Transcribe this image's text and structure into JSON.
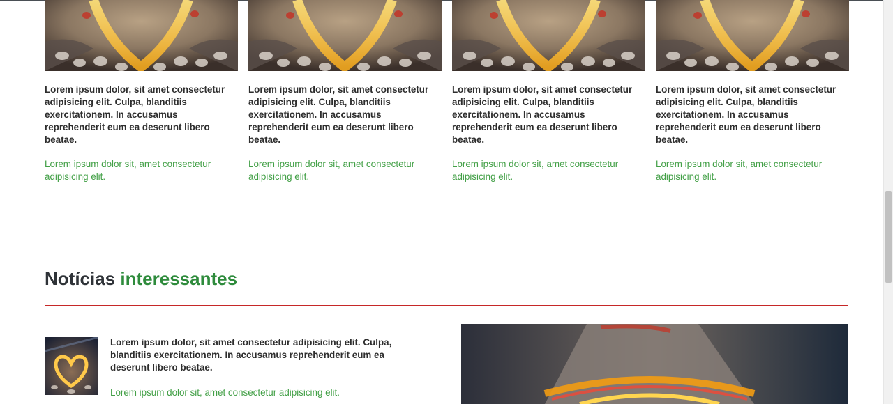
{
  "cards": [
    {
      "title": "Lorem ipsum dolor, sit amet consectetur adipisicing elit. Culpa, blanditiis exercitationem. In accusamus reprehenderit eum ea deserunt libero beatae.",
      "subtitle": "Lorem ipsum dolor sit, amet consectetur adipisicing elit."
    },
    {
      "title": "Lorem ipsum dolor, sit amet consectetur adipisicing elit. Culpa, blanditiis exercitationem. In accusamus reprehenderit eum ea deserunt libero beatae.",
      "subtitle": "Lorem ipsum dolor sit, amet consectetur adipisicing elit."
    },
    {
      "title": "Lorem ipsum dolor, sit amet consectetur adipisicing elit. Culpa, blanditiis exercitationem. In accusamus reprehenderit eum ea deserunt libero beatae.",
      "subtitle": "Lorem ipsum dolor sit, amet consectetur adipisicing elit."
    },
    {
      "title": "Lorem ipsum dolor, sit amet consectetur adipisicing elit. Culpa, blanditiis exercitationem. In accusamus reprehenderit eum ea deserunt libero beatae.",
      "subtitle": "Lorem ipsum dolor sit, amet consectetur adipisicing elit."
    }
  ],
  "news_section": {
    "title_part1": "Notícias",
    "title_part2": "interessantes",
    "item": {
      "title": "Lorem ipsum dolor, sit amet consectetur adipisicing elit. Culpa, blanditiis exercitationem. In accusamus reprehenderit eum ea deserunt libero beatae.",
      "subtitle": "Lorem ipsum dolor sit, amet consectetur adipisicing elit."
    }
  },
  "colors": {
    "accent_green": "#2e8b3c",
    "link_green": "#43a047",
    "divider_red": "#c62828",
    "heading_dark": "#2f3338"
  }
}
